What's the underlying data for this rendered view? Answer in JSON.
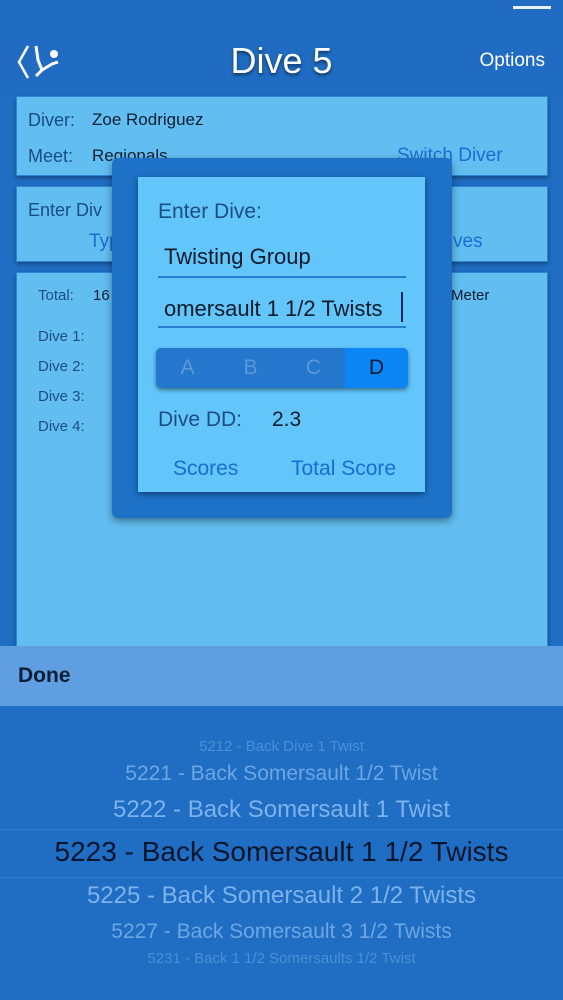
{
  "header": {
    "title": "Dive 5",
    "options_label": "Options"
  },
  "diver_card": {
    "diver_label": "Diver:",
    "diver_name": "Zoe Rodriguez",
    "meet_label": "Meet:",
    "meet_name": "Regionals",
    "switch_label": "Switch Diver"
  },
  "enter_card": {
    "label_partial": "Enter Div",
    "type_partial": "Typ",
    "right_partial": "ves"
  },
  "scores_card": {
    "total_label": "Total:",
    "total_value_partial": "16",
    "board_partial": "Meter",
    "dives": [
      {
        "label": "Dive 1:"
      },
      {
        "label": "Dive 2:"
      },
      {
        "label": "Dive 3:"
      },
      {
        "label": "Dive 4:"
      }
    ]
  },
  "modal": {
    "heading": "Enter Dive:",
    "group_value": "Twisting Group",
    "dive_value": "omersault 1 1/2 Twists",
    "positions": [
      "A",
      "B",
      "C",
      "D"
    ],
    "selected_position": "D",
    "dd_label": "Dive DD:",
    "dd_value": "2.3",
    "scores_label": "Scores",
    "total_score_label": "Total Score"
  },
  "picker": {
    "done_label": "Done",
    "rows": [
      "5212 - Back Dive 1 Twist",
      "5221 - Back Somersault  1/2 Twist",
      "5222 - Back Somersault 1 Twist",
      "5223 - Back Somersault 1 1/2 Twists",
      "5225 - Back Somersault 2 1/2 Twists",
      "5227 - Back Somersault 3 1/2 Twists",
      "5231 - Back 1 1/2 Somersaults  1/2 Twist"
    ],
    "selected_index": 3
  },
  "colors": {
    "background": "#1f6ec4",
    "card": "#62bdf0",
    "accent": "#0c86f4"
  }
}
